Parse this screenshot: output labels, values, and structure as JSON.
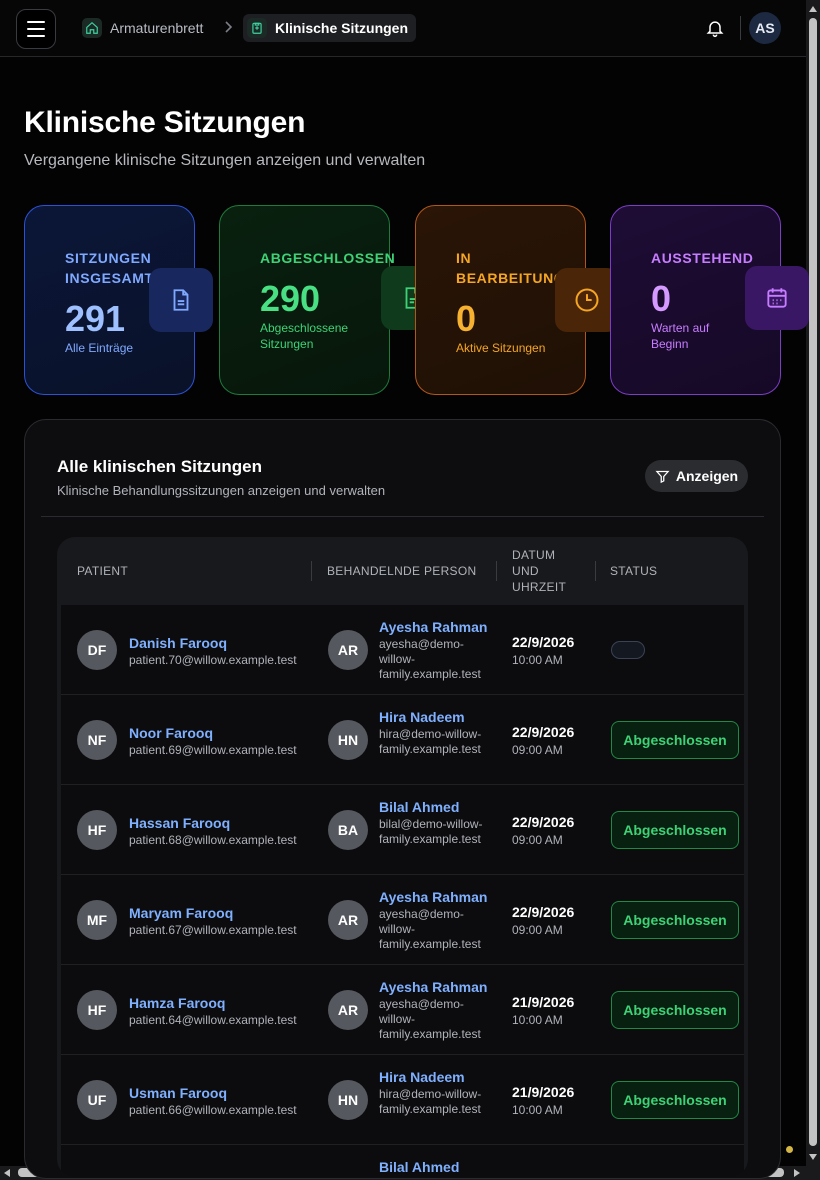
{
  "header": {
    "breadcrumb_home": "Armaturenbrett",
    "breadcrumb_current": "Klinische Sitzungen",
    "user_initials": "AS"
  },
  "page": {
    "title": "Klinische Sitzungen",
    "subtitle": "Vergangene klinische Sitzungen anzeigen und verwalten"
  },
  "stats": [
    {
      "label": "SITZUNGEN INSGESAMT",
      "value": "291",
      "desc": "Alle Einträge",
      "color": "#7fa8ff",
      "icon": "document-icon"
    },
    {
      "label": "ABGESCHLOSSEN",
      "value": "290",
      "desc": "Abgeschlossene Sitzungen",
      "color": "#3ed277",
      "icon": "document-check-icon"
    },
    {
      "label": "IN BEARBEITUNG",
      "value": "0",
      "desc": "Aktive Sitzungen",
      "color": "#f5a623",
      "icon": "clock-icon"
    },
    {
      "label": "AUSSTEHEND",
      "value": "0",
      "desc": "Warten auf Beginn",
      "color": "#c77dff",
      "icon": "calendar-icon"
    }
  ],
  "panel": {
    "title": "Alle klinischen Sitzungen",
    "subtitle": "Klinische Behandlungssitzungen anzeigen und verwalten",
    "filter_label": "Anzeigen"
  },
  "table": {
    "headers": {
      "patient": "PATIENT",
      "therapist": "BEHANDELNDE PERSON",
      "datetime_1": "DATUM",
      "datetime_2": "UND",
      "datetime_3": "UHRZEIT",
      "status": "STATUS"
    },
    "rows": [
      {
        "initials": "DF",
        "name": "Danish Farooq",
        "email": "patient.70@willow.example.test",
        "t_initials": "AR",
        "t_name": "Ayesha Rahman",
        "t_email": "ayesha@demo-willow-family.example.test",
        "date": "22/9/2026",
        "time": "10:00 AM",
        "status": ""
      },
      {
        "initials": "NF",
        "name": "Noor Farooq",
        "email": "patient.69@willow.example.test",
        "t_initials": "HN",
        "t_name": "Hira Nadeem",
        "t_email": "hira@demo-willow-family.example.test",
        "date": "22/9/2026",
        "time": "09:00 AM",
        "status": "Abgeschlossen"
      },
      {
        "initials": "HF",
        "name": "Hassan Farooq",
        "email": "patient.68@willow.example.test",
        "t_initials": "BA",
        "t_name": "Bilal Ahmed",
        "t_email": "bilal@demo-willow-family.example.test",
        "date": "22/9/2026",
        "time": "09:00 AM",
        "status": "Abgeschlossen"
      },
      {
        "initials": "MF",
        "name": "Maryam Farooq",
        "email": "patient.67@willow.example.test",
        "t_initials": "AR",
        "t_name": "Ayesha Rahman",
        "t_email": "ayesha@demo-willow-family.example.test",
        "date": "22/9/2026",
        "time": "09:00 AM",
        "status": "Abgeschlossen"
      },
      {
        "initials": "HF",
        "name": "Hamza Farooq",
        "email": "patient.64@willow.example.test",
        "t_initials": "AR",
        "t_name": "Ayesha Rahman",
        "t_email": "ayesha@demo-willow-family.example.test",
        "date": "21/9/2026",
        "time": "10:00 AM",
        "status": "Abgeschlossen"
      },
      {
        "initials": "UF",
        "name": "Usman Farooq",
        "email": "patient.66@willow.example.test",
        "t_initials": "HN",
        "t_name": "Hira Nadeem",
        "t_email": "hira@demo-willow-family.example.test",
        "date": "21/9/2026",
        "time": "10:00 AM",
        "status": "Abgeschlossen"
      },
      {
        "initials": "",
        "name": "",
        "email": "",
        "t_initials": "",
        "t_name": "Bilal Ahmed",
        "t_email": "",
        "date": "",
        "time": "",
        "status": ""
      }
    ]
  }
}
